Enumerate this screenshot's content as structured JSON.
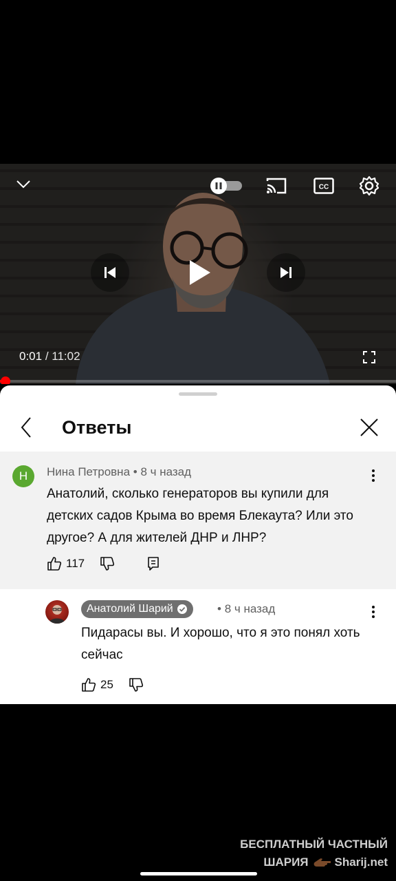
{
  "player": {
    "current_time": "0:01",
    "separator": " / ",
    "duration": "11:02",
    "progress_fraction": 0.002,
    "autoplay_toggle": "on",
    "icons": [
      "chevron-down-icon",
      "autoplay-toggle-icon",
      "cast-icon",
      "captions-icon",
      "settings-gear-icon",
      "previous-icon",
      "play-icon",
      "next-icon",
      "fullscreen-icon"
    ]
  },
  "sheet": {
    "title": "Ответы"
  },
  "parent_comment": {
    "avatar_letter": "Н",
    "author": "Нина Петровна",
    "dot": " • ",
    "time": "8 ч назад",
    "text": "Анатолий, сколько генераторов вы купили для детских садов Крыма во время Блекаута? Или это другое? А для жителей ДНР и ЛНР?",
    "likes": "117"
  },
  "reply_comment": {
    "author": "Анатолий Шарий",
    "dot": " • ",
    "time": "8 ч назад",
    "text": "Пидарасы вы. И хорошо, что я это понял хоть сейчас",
    "likes": "25"
  },
  "watermark": {
    "line1": "БЕСПЛАТНЫЙ ЧАСТНЫЙ",
    "line2a": "ШАРИЯ",
    "line2b": "Sharij.net"
  },
  "colors": {
    "accent_red": "#ff0000",
    "avatar_green": "#5aa830",
    "author_chip": "#6f6f6f",
    "parent_bg": "#f2f2f2"
  }
}
